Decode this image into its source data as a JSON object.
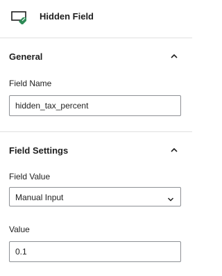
{
  "header": {
    "title": "Hidden Field",
    "icon": "hidden-field-icon",
    "icon_color": "#2e8b57"
  },
  "panels": [
    {
      "title": "General",
      "expanded": true,
      "fields": {
        "field_name_label": "Field Name",
        "field_name_value": "hidden_tax_percent"
      }
    },
    {
      "title": "Field Settings",
      "expanded": true,
      "fields": {
        "field_value_label": "Field Value",
        "field_value_selected": "Manual Input",
        "value_label": "Value",
        "value_value": "0.1"
      }
    }
  ]
}
